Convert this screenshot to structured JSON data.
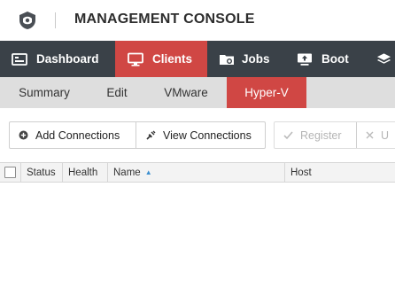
{
  "header": {
    "title": "MANAGEMENT CONSOLE",
    "logo_icon": "shield-logo-icon"
  },
  "main_nav": [
    {
      "label": "Dashboard",
      "icon": "dashboard-icon",
      "active": false
    },
    {
      "label": "Clients",
      "icon": "monitor-icon",
      "active": true
    },
    {
      "label": "Jobs",
      "icon": "jobs-icon",
      "active": false
    },
    {
      "label": "Boot",
      "icon": "boot-icon",
      "active": false
    },
    {
      "label": "",
      "icon": "layers-icon",
      "active": false
    }
  ],
  "sub_nav": [
    {
      "label": "Summary",
      "active": false
    },
    {
      "label": "Edit",
      "active": false
    },
    {
      "label": "VMware",
      "active": false
    },
    {
      "label": "Hyper-V",
      "active": true
    }
  ],
  "toolbar": {
    "add_connections": "Add Connections",
    "view_connections": "View Connections",
    "register": "Register",
    "unregister_partial": "U"
  },
  "table": {
    "columns": [
      "Status",
      "Health",
      "Name",
      "Host"
    ],
    "sorted_column": "Name",
    "sort_direction": "ascending",
    "rows": []
  },
  "colors": {
    "nav_bg": "#3a4148",
    "accent": "#d04744",
    "subnav_bg": "#dedede"
  }
}
